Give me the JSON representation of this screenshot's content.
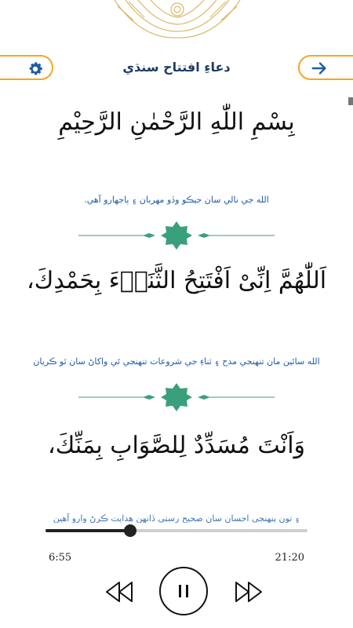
{
  "header": {
    "title": "دعاءِ افتتاح سنڌي",
    "settings_icon": "gear-icon",
    "next_icon": "arrow-right-icon"
  },
  "content": {
    "bismillah": "بِسْمِ اللّٰهِ الرَّحْمٰنِ الرَّحِيْمِ",
    "bismillah_translation": "الله جي نالي سان جيڪو وڏو مهربان ۽ ٻاجهارو آهي.",
    "verse_1": "اَللّٰهُمَّ اِنِّىْ اَفْتَتِحُ الثَّنَاۤءَ بِحَمْدِكَ،",
    "verse_1_translation": "الله سائين مان تنهنجي مدح ۽ ثناءِ جي شروعات تنهنجي ئي واکاڻ سان ٿو ڪريان",
    "verse_2": "وَاَنْتَ مُسَدِّدٌ لِلصَّوَابِ بِمَنِّكَ،",
    "verse_3_translation": "۽ تون پنهنجي احسان سان صحيح رستي ڏانهن هدايت ڪرڻ وارو آهين"
  },
  "player": {
    "elapsed": "6:55",
    "total": "21:20",
    "progress": 0.324,
    "rewind_icon": "rewind-icon",
    "pause_icon": "pause-icon",
    "forward_icon": "fast-forward-icon"
  },
  "colors": {
    "accent_orange": "#f5a623",
    "link_blue": "#1f5aa6",
    "title_navy": "#1f3a63",
    "divider_green": "#3aa07c"
  }
}
